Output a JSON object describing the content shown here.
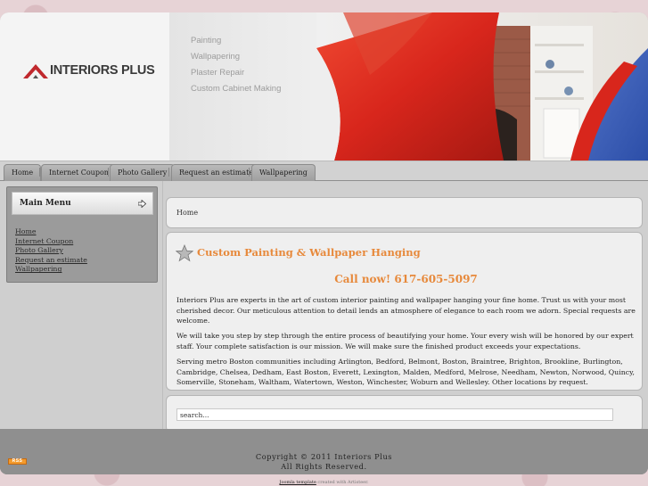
{
  "header": {
    "logo_text": "INTERIORS PLUS",
    "services": [
      "Painting",
      "Wallpapering",
      "Plaster Repair",
      "Custom Cabinet Making"
    ]
  },
  "tabs": [
    {
      "label": "Home"
    },
    {
      "label": "Internet Coupon"
    },
    {
      "label": "Photo Gallery"
    },
    {
      "label": "Request an estimate"
    },
    {
      "label": "Wallpapering"
    }
  ],
  "sidebar": {
    "title": "Main Menu",
    "items": [
      {
        "label": "Home"
      },
      {
        "label": "Internet Coupon"
      },
      {
        "label": "Photo Gallery"
      },
      {
        "label": "Request an estimate"
      },
      {
        "label": "Wallpapering"
      }
    ]
  },
  "breadcrumb": "Home",
  "article": {
    "title": "Custom Painting & Wallpaper Hanging",
    "call": "Call now! 617-605-5097",
    "paragraphs": [
      "Interiors Plus are experts in the art of custom interior painting and wallpaper hanging your fine home. Trust us with your most cherished decor. Our meticulous attention to detail lends an atmosphere of elegance to each room we adorn. Special requests are welcome.",
      "We will take you step by step through the entire process of beautifying your home. Your every wish will be honored by our expert staff. Your complete satisfaction is our mission. We will make sure the finished product exceeds your expectations.",
      "Serving metro Boston communities including Arlington, Bedford, Belmont, Boston, Braintree, Brighton, Brookline, Burlington, Cambridge, Chelsea, Dedham, East Boston, Everett, Lexington, Malden, Medford, Melrose, Needham, Newton, Norwood, Quincy, Somerville, Stoneham, Waltham, Watertown, Weston, Winchester, Woburn and Wellesley. Other locations by request."
    ]
  },
  "search": {
    "value": "search..."
  },
  "footer": {
    "rss_label": "RSS",
    "copyright": "Copyright © 2011 Interiors Plus",
    "rights": "All Rights Reserved."
  },
  "credit": {
    "link": "Joomla template",
    "text": " created with Artisteer."
  },
  "colors": {
    "accent": "#e7893b",
    "header_bg": "#f1f1f1",
    "frame": "#8e8e8e"
  },
  "icons": {
    "menu_arrow": "arrow-right-icon",
    "article_icon": "star-icon",
    "rss": "rss-icon"
  }
}
